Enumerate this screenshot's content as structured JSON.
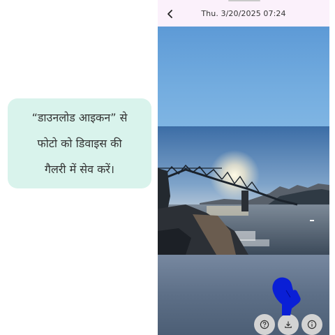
{
  "instruction": {
    "line1": "“डाउनलोड आइकन” से",
    "line2": "फोटो को डिवाइस की",
    "line3": "गैलरी में सेव करें।"
  },
  "header": {
    "date_time": "Thu. 3/20/2025  07:24",
    "back_icon": "chevron-left-icon"
  },
  "photo": {
    "subject": "bridge-over-water-at-sunset"
  },
  "actions": [
    {
      "icon": "help-icon"
    },
    {
      "icon": "download-icon"
    },
    {
      "icon": "info-icon"
    }
  ],
  "colors": {
    "callout_bg": "#d9f3ec",
    "header_bg": "#fbf1fb",
    "pointer": "#0a1fd6",
    "action_bg": "#d3d3d3"
  }
}
